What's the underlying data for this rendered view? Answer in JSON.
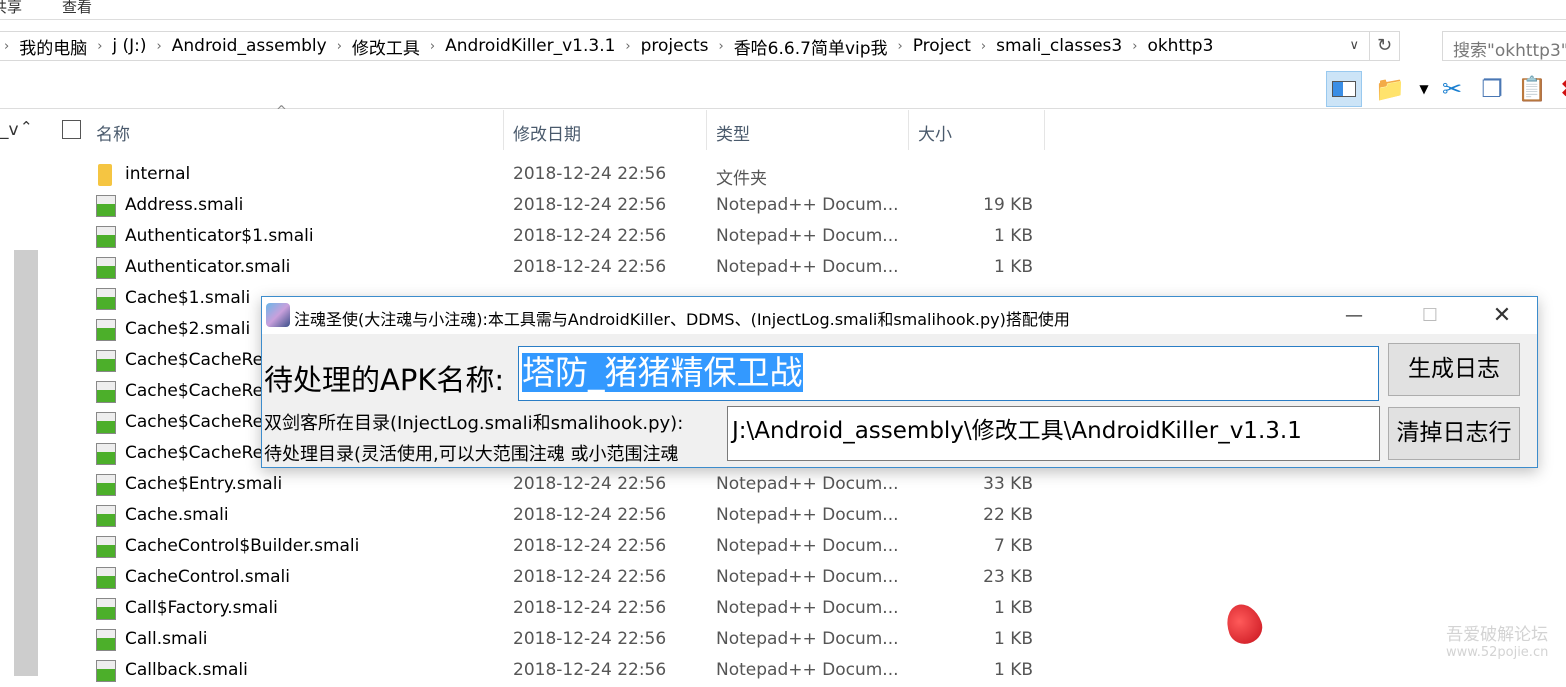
{
  "ribbon": {
    "tabs": [
      "共享",
      "查看"
    ]
  },
  "address": {
    "crumbs": [
      "我的电脑",
      "j (J:)",
      "Android_assembly",
      "修改工具",
      "AndroidKiller_v1.3.1",
      "projects",
      "香哈6.6.7简单vip我",
      "Project",
      "smali_classes3",
      "okhttp3"
    ]
  },
  "search": {
    "placeholder": "搜索\"okhttp3\""
  },
  "left_pane": {
    "label": "_v"
  },
  "columns": {
    "name": "名称",
    "date": "修改日期",
    "type": "类型",
    "size": "大小"
  },
  "files": [
    {
      "name": "internal",
      "date": "2018-12-24 22:56",
      "type": "文件夹",
      "size": "",
      "kind": "folder"
    },
    {
      "name": "Address.smali",
      "date": "2018-12-24 22:56",
      "type": "Notepad++ Docum...",
      "size": "19 KB"
    },
    {
      "name": "Authenticator$1.smali",
      "date": "2018-12-24 22:56",
      "type": "Notepad++ Docum...",
      "size": "1 KB"
    },
    {
      "name": "Authenticator.smali",
      "date": "2018-12-24 22:56",
      "type": "Notepad++ Docum...",
      "size": "1 KB"
    },
    {
      "name": "Cache$1.smali",
      "date": "",
      "type": "",
      "size": ""
    },
    {
      "name": "Cache$2.smali",
      "date": "",
      "type": "",
      "size": ""
    },
    {
      "name": "Cache$CacheRe",
      "date": "",
      "type": "",
      "size": ""
    },
    {
      "name": "Cache$CacheRe",
      "date": "",
      "type": "",
      "size": ""
    },
    {
      "name": "Cache$CacheRe",
      "date": "",
      "type": "",
      "size": ""
    },
    {
      "name": "Cache$CacheRe",
      "date": "",
      "type": "",
      "size": ""
    },
    {
      "name": "Cache$Entry.smali",
      "date": "2018-12-24 22:56",
      "type": "Notepad++ Docum...",
      "size": "33 KB"
    },
    {
      "name": "Cache.smali",
      "date": "2018-12-24 22:56",
      "type": "Notepad++ Docum...",
      "size": "22 KB"
    },
    {
      "name": "CacheControl$Builder.smali",
      "date": "2018-12-24 22:56",
      "type": "Notepad++ Docum...",
      "size": "7 KB"
    },
    {
      "name": "CacheControl.smali",
      "date": "2018-12-24 22:56",
      "type": "Notepad++ Docum...",
      "size": "23 KB"
    },
    {
      "name": "Call$Factory.smali",
      "date": "2018-12-24 22:56",
      "type": "Notepad++ Docum...",
      "size": "1 KB"
    },
    {
      "name": "Call.smali",
      "date": "2018-12-24 22:56",
      "type": "Notepad++ Docum...",
      "size": "1 KB"
    },
    {
      "name": "Callback.smali",
      "date": "2018-12-24 22:56",
      "type": "Notepad++ Docum...",
      "size": "1 KB"
    }
  ],
  "dialog": {
    "title": "注魂圣使(大注魂与小注魂):本工具需与AndroidKiller、DDMS、(InjectLog.smali和smalihook.py)搭配使用",
    "apk_label": "待处理的APK名称:",
    "apk_value": "塔防_猪猪精保卫战",
    "dir_label1": "双剑客所在目录(InjectLog.smali和smalihook.py):",
    "dir_label2": "待处理目录(灵活使用,可以大范围注魂 或小范围注魂",
    "dir_value": "J:\\Android_assembly\\修改工具\\AndroidKiller_v1.3.1",
    "btn_generate": "生成日志",
    "btn_clear": "清掉日志行"
  },
  "watermark": {
    "line1": "吾爱破解论坛",
    "line2": "www.52pojie.cn"
  },
  "colors": {
    "accent": "#3399ff",
    "dialog_border": "#3c8ccc"
  }
}
